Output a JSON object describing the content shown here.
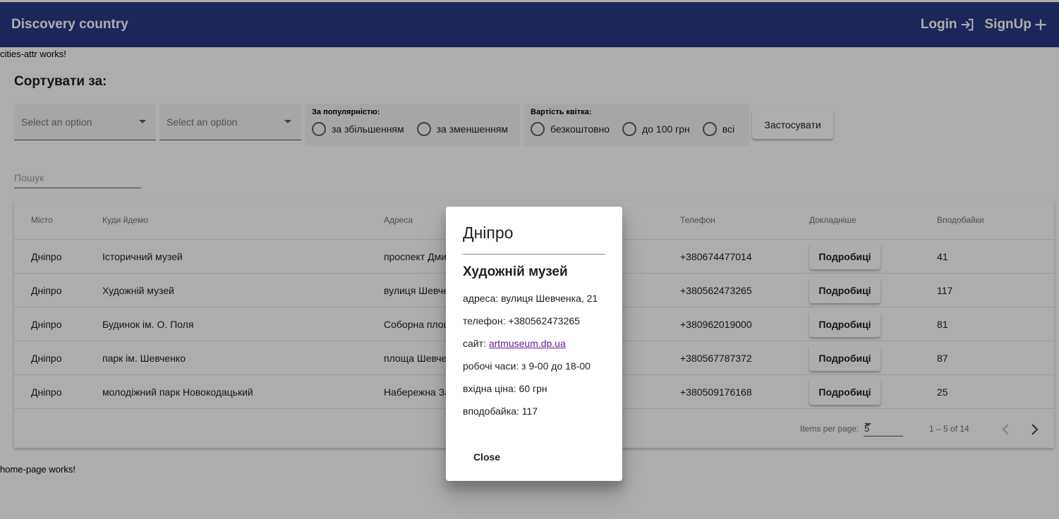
{
  "header": {
    "title": "Discovery country",
    "login_label": "Login",
    "signup_label": "SignUp",
    "background_color": "#2c3987"
  },
  "notes": {
    "cities_attr": "cities-attr works!",
    "home_page": "home-page works!"
  },
  "sort": {
    "title": "Сортувати за:",
    "select1_value": "Select an option",
    "select2_value": "Select an option",
    "popularity": {
      "label": "За популярністю:",
      "options": [
        "за збільшенням",
        "за зменшенням"
      ]
    },
    "price": {
      "label": "Вартість квітка:",
      "options": [
        "безкоштовно",
        "до 100 грн",
        "всі"
      ]
    },
    "apply_label": "Застосувати"
  },
  "search": {
    "placeholder": "Пошук",
    "value": ""
  },
  "table": {
    "columns": [
      "Місто",
      "Куди йдемо",
      "Адреса",
      "Телефон",
      "Докладніше",
      "Вподобайки"
    ],
    "rows": [
      {
        "city": "Дніпро",
        "place": "Історичний музей",
        "address": "проспект Дмитра Яворницького, 18",
        "phone": "+380674477014",
        "details": "Подробиці",
        "likes": "41"
      },
      {
        "city": "Дніпро",
        "place": "Художній музей",
        "address": "вулиця Шевченка, 21",
        "phone": "+380562473265",
        "details": "Подробиці",
        "likes": "117"
      },
      {
        "city": "Дніпро",
        "place": "Будинок ім. О. Поля",
        "address": "Соборна площа, 11",
        "phone": "+380962019000",
        "details": "Подробиці",
        "likes": "81"
      },
      {
        "city": "Дніпро",
        "place": "парк ім. Шевченко",
        "address": "площа Шевченка, 1",
        "phone": "+380567787372",
        "details": "Подробиці",
        "likes": "87"
      },
      {
        "city": "Дніпро",
        "place": "молодіжний парк Новокодацький",
        "address": "Набережна Заводська",
        "phone": "+380509176168",
        "details": "Подробиці",
        "likes": "25"
      }
    ],
    "paginator": {
      "items_per_page_label": "Items per page:",
      "page_size": "5",
      "range_label": "1 – 5 of 14"
    }
  },
  "dialog": {
    "title": "Дніпро",
    "subtitle": "Художній музей",
    "address_line": "адреса: вулиця Шевченка, 21",
    "phone_line": "телефон: +380562473265",
    "site_prefix": "сайт: ",
    "site_link": "artmuseum.dp.ua",
    "hours_line": "робочі часи: з 9-00 до 18-00",
    "price_line": "вхідна ціна: 60 грн",
    "likes_line": "вподобайка: 117",
    "close_label": "Close"
  }
}
